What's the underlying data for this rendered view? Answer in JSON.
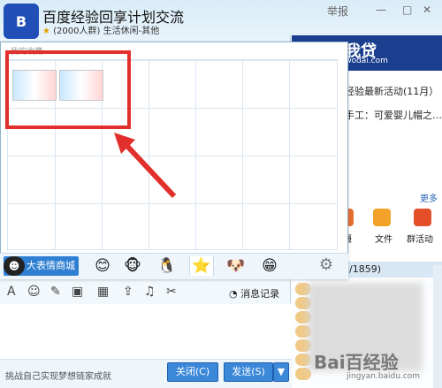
{
  "header": {
    "logo_text": "B",
    "title": "百度经验回享计划交流",
    "star": "★",
    "subtitle": "(2000人群) 生活休闲-其他",
    "report": "举报",
    "min": "—",
    "max": "□",
    "close": "✕"
  },
  "right_panel": {
    "ad_brand": "你我贷",
    "ad_url": "niwodai.com",
    "ad_mark": "⚑",
    "news1": "经验最新活动(11月）",
    "news2": "手工：可爱婴儿帽之…",
    "more": "更多",
    "icon_labels": [
      "摄",
      "文件",
      "群活动"
    ],
    "list_header": "/1859)"
  },
  "emoji_panel": {
    "title": "我的收藏",
    "big_btn": "大表情商城",
    "tabs": [
      "😊",
      "🐵",
      "🐧",
      "⭐",
      "🐶",
      "😁"
    ],
    "settings": "⚙"
  },
  "toolbar": {
    "items": [
      "A",
      "☺",
      "✎",
      "▣",
      "▦",
      "⇪",
      "♫",
      "✂"
    ],
    "message_record": "消息记录"
  },
  "footer": {
    "slogan": "挑战自己实现梦想链家成就",
    "close": "关闭(C)",
    "send": "发送(S)",
    "dropdown": "▼"
  },
  "watermark": {
    "text": "Bai百经验",
    "url": "jingyan.baidu.com"
  }
}
